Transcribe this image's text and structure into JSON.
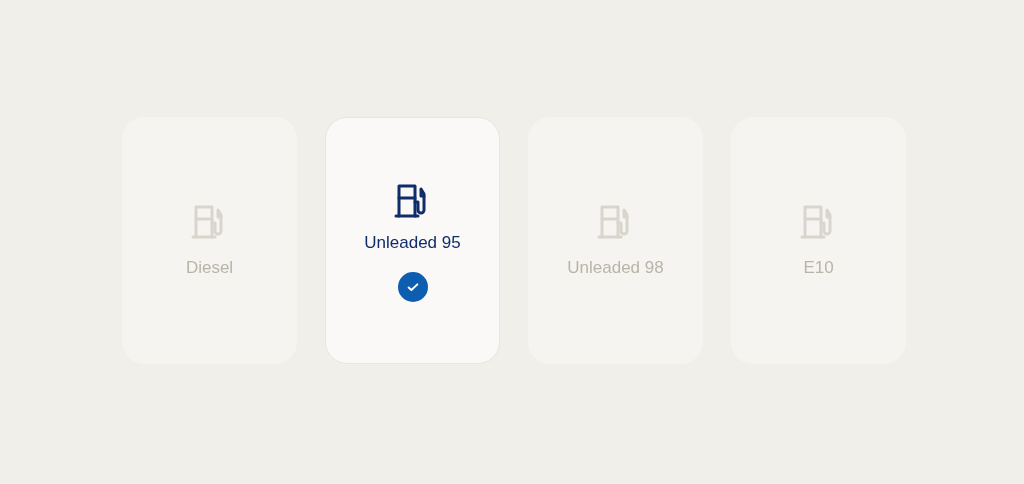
{
  "fuel_options": [
    {
      "label": "Diesel",
      "selected": false
    },
    {
      "label": "Unleaded 95",
      "selected": true
    },
    {
      "label": "Unleaded 98",
      "selected": false
    },
    {
      "label": "E10",
      "selected": false
    }
  ]
}
